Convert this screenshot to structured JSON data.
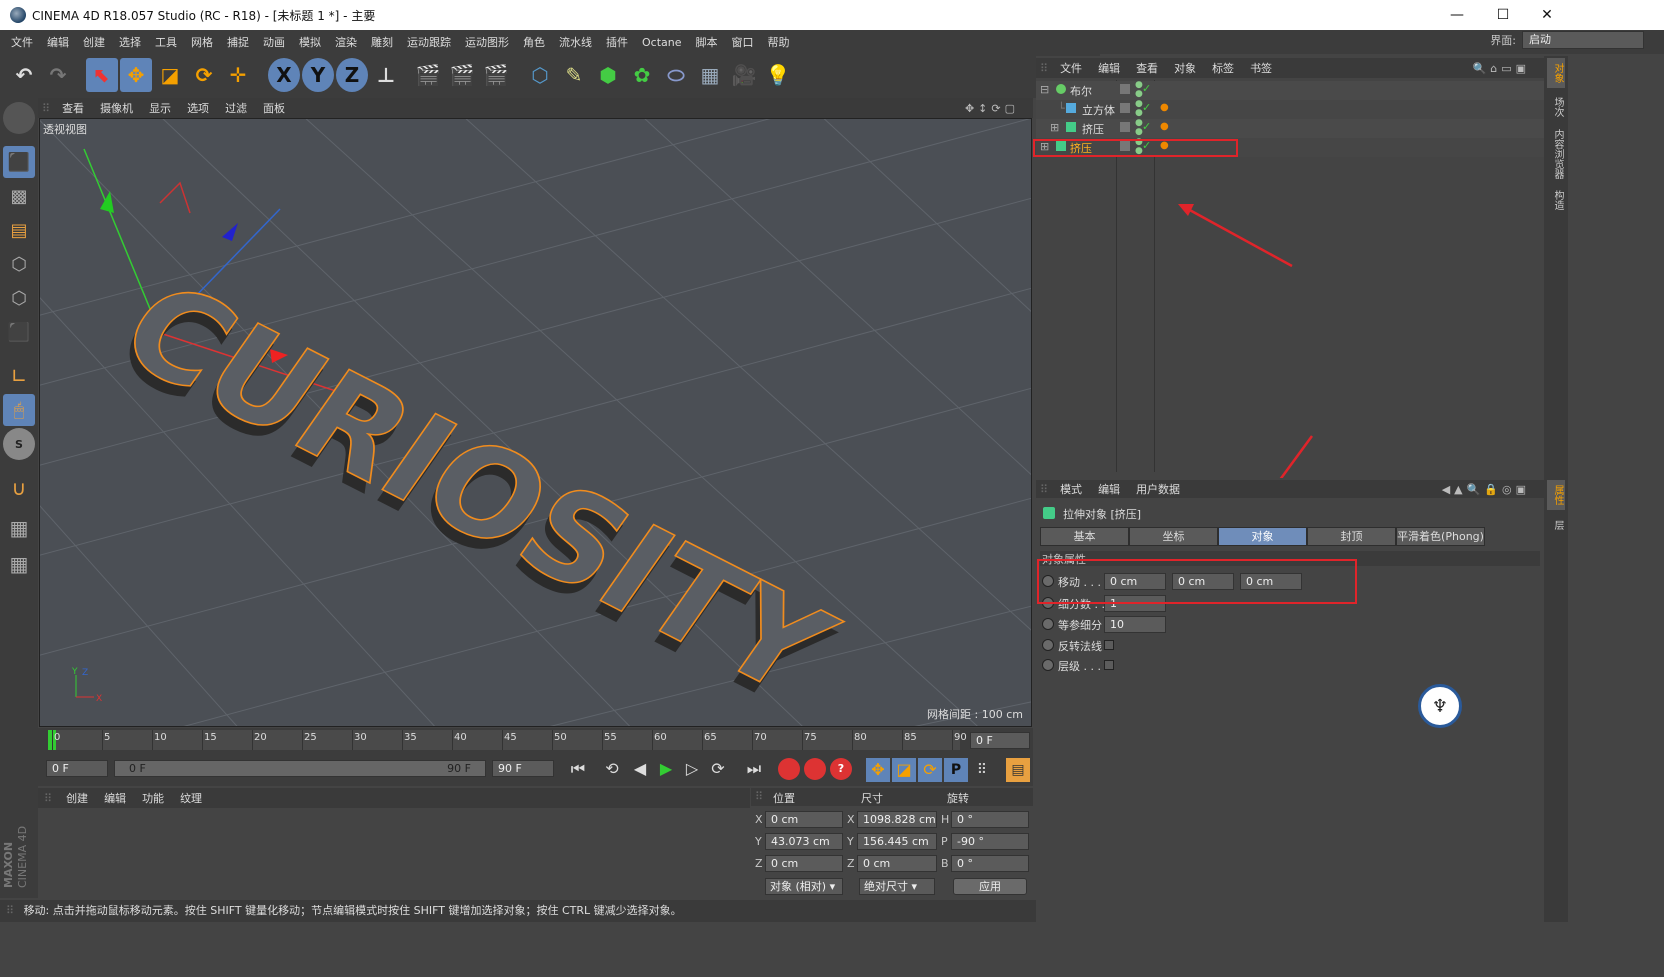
{
  "window": {
    "title": "CINEMA 4D R18.057 Studio (RC - R18) - [未标题 1 *] - 主要",
    "minimize": "—",
    "maximize": "☐",
    "close": "✕"
  },
  "menu": [
    "文件",
    "编辑",
    "创建",
    "选择",
    "工具",
    "网格",
    "捕捉",
    "动画",
    "模拟",
    "渲染",
    "雕刻",
    "运动跟踪",
    "运动图形",
    "角色",
    "流水线",
    "插件",
    "Octane",
    "脚本",
    "窗口",
    "帮助"
  ],
  "layout": {
    "label": "界面:",
    "value": "启动"
  },
  "toolbar_axes": [
    "X",
    "Y",
    "Z"
  ],
  "viewport": {
    "menu": [
      "查看",
      "摄像机",
      "显示",
      "选项",
      "过滤",
      "面板"
    ],
    "label": "透视视图",
    "grid_spacing": "网格间距 : 100 cm",
    "text3d": "CURIOSITY"
  },
  "object_manager": {
    "menu": [
      "文件",
      "编辑",
      "查看",
      "对象",
      "标签",
      "书签"
    ],
    "rows": [
      {
        "name": "布尔",
        "expand": "⊟"
      },
      {
        "name": "立方体",
        "expand": ""
      },
      {
        "name": "挤压",
        "expand": "⊞"
      },
      {
        "name": "挤压",
        "expand": "⊞"
      }
    ]
  },
  "attribute_manager": {
    "menu": [
      "模式",
      "编辑",
      "用户数据"
    ],
    "header": "拉伸对象 [挤压]",
    "tabs": [
      "基本",
      "坐标",
      "对象",
      "封顶",
      "平滑着色(Phong)"
    ],
    "section": "对象属性",
    "move_label": "移动 . . .",
    "move_values": [
      "0 cm",
      "0 cm",
      "0 cm"
    ],
    "subdivision_label": "细分数 . .",
    "subdivision_value": "1",
    "isoparm_label": "等参细分",
    "isoparm_value": "10",
    "flip_normals_label": "反转法线",
    "hierarchical_label": "层级 . . ."
  },
  "right_tabs": [
    "对象",
    "场次",
    "内容浏览器",
    "构造",
    "属性",
    "层"
  ],
  "timeline": {
    "ticks": [
      "0",
      "5",
      "10",
      "15",
      "20",
      "25",
      "30",
      "35",
      "40",
      "45",
      "50",
      "55",
      "60",
      "65",
      "70",
      "75",
      "80",
      "85",
      "90"
    ],
    "current_frame": "0 F"
  },
  "transport": {
    "start": "0 F",
    "slider_left": "0 F",
    "slider_right": "90 F",
    "end": "90 F"
  },
  "material_manager": {
    "menu": [
      "创建",
      "编辑",
      "功能",
      "纹理"
    ]
  },
  "coords": {
    "headers": [
      "位置",
      "尺寸",
      "旋转"
    ],
    "rows": [
      {
        "a": "X",
        "pos": "0 cm",
        "b": "X",
        "size": "1098.828 cm",
        "c": "H",
        "rot": "0 °"
      },
      {
        "a": "Y",
        "pos": "43.073 cm",
        "b": "Y",
        "size": "156.445 cm",
        "c": "P",
        "rot": "-90 °"
      },
      {
        "a": "Z",
        "pos": "0 cm",
        "b": "Z",
        "size": "0 cm",
        "c": "B",
        "rot": "0 °"
      }
    ],
    "mode1": "对象 (相对)",
    "mode2": "绝对尺寸",
    "apply": "应用"
  },
  "status": "移动: 点击并拖动鼠标移动元素。按住 SHIFT 键量化移动；节点编辑模式时按住 SHIFT 键增加选择对象；按住 CTRL 键减少选择对象。",
  "brand": {
    "maxon": "MAXON",
    "c4d": "CINEMA 4D"
  },
  "colors": {
    "accent": "#5f84b8",
    "highlight": "#ffb020",
    "annotation": "#e0242a",
    "outline": "#f08c1e"
  }
}
